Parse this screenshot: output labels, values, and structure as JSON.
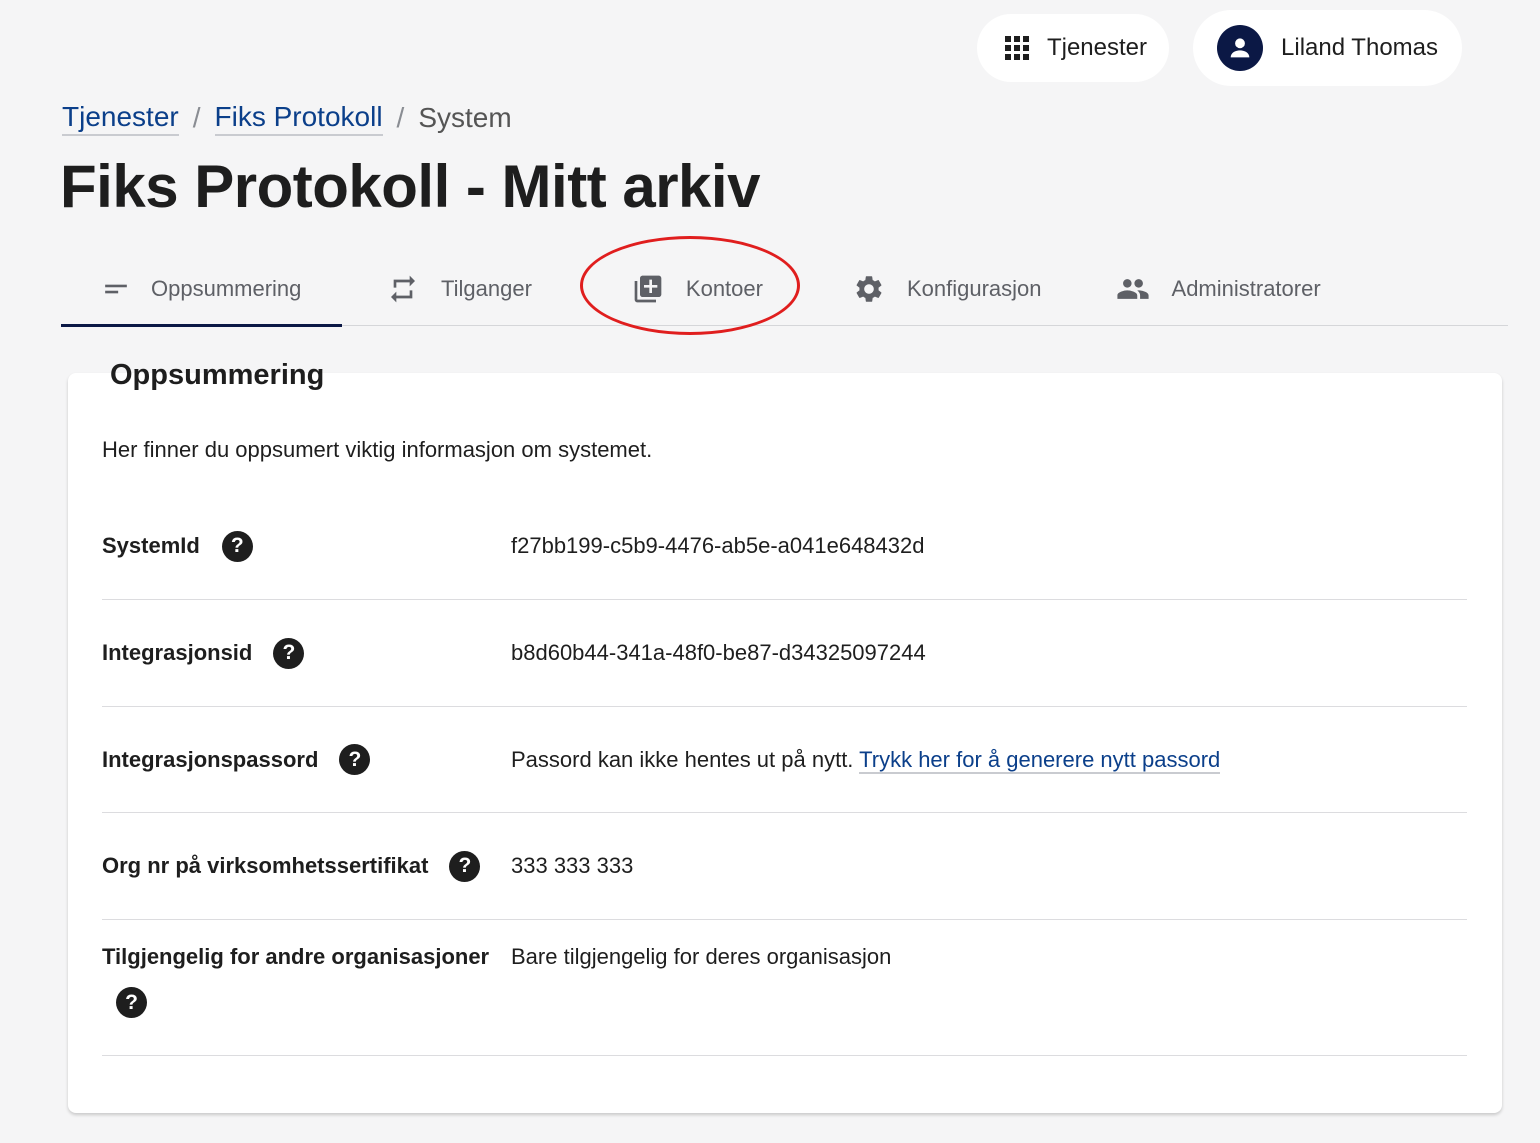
{
  "topbar": {
    "services_label": "Tjenester",
    "user_name": "Liland Thomas"
  },
  "breadcrumb": {
    "items": [
      "Tjenester",
      "Fiks Protokoll"
    ],
    "separator": "/",
    "current": "System"
  },
  "page_title": "Fiks Protokoll - Mitt arkiv",
  "tabs": [
    {
      "label": "Oppsummering",
      "icon": "short-text-icon",
      "active": true
    },
    {
      "label": "Tilganger",
      "icon": "repeat-icon",
      "active": false
    },
    {
      "label": "Kontoer",
      "icon": "library-add-icon",
      "active": false,
      "highlighted": true
    },
    {
      "label": "Konfigurasjon",
      "icon": "gear-icon",
      "active": false
    },
    {
      "label": "Administratorer",
      "icon": "people-icon",
      "active": false
    }
  ],
  "summary": {
    "title": "Oppsummering",
    "intro": "Her finner du oppsumert viktig informasjon om systemet.",
    "rows": [
      {
        "label": "SystemId",
        "value": "f27bb199-c5b9-4476-ab5e-a041e648432d"
      },
      {
        "label": "Integrasjonsid",
        "value": "b8d60b44-341a-48f0-be87-d34325097244"
      },
      {
        "label": "Integrasjonspassord",
        "value": "Passord kan ikke hentes ut på nytt.",
        "link": "Trykk her for å generere nytt passord"
      },
      {
        "label": "Org nr på virksomhetssertifikat",
        "value": "333 333 333"
      },
      {
        "label": "Tilgjengelig for andre organisasjoner",
        "value": "Bare tilgjengelig for deres organisasjon"
      }
    ]
  },
  "colors": {
    "accent": "#0b1845",
    "link": "#0b3f8a",
    "annotation": "#e01e1e",
    "background": "#f5f5f6"
  }
}
